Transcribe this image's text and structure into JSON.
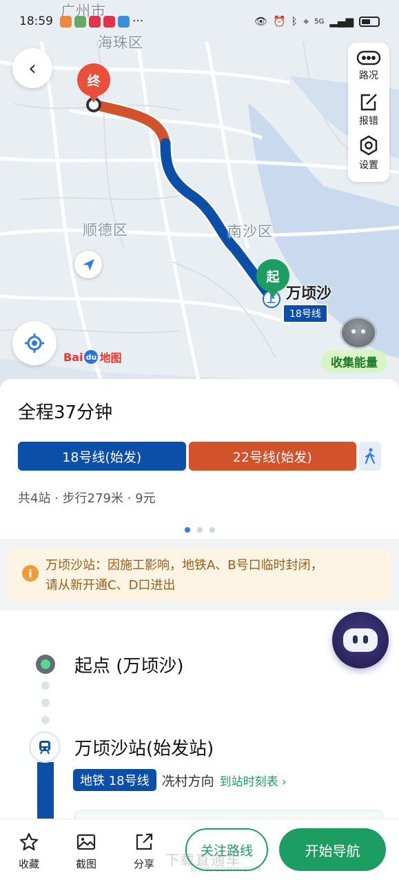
{
  "status_bar": {
    "time": "18:59",
    "dots": "···",
    "network": "5G"
  },
  "map": {
    "labels": [
      "广州市",
      "海珠区",
      "顺德区",
      "南沙区"
    ],
    "start_pin": "起",
    "end_pin": "终",
    "station_name": "万顷沙",
    "line_badge": "18号线",
    "boarding_marker": "上",
    "logo_text": "Bai",
    "logo_du": "du",
    "logo_suffix": "地图",
    "energy_label": "收集能量",
    "tools": [
      {
        "icon": "traffic-icon",
        "label": "路况"
      },
      {
        "icon": "report-icon",
        "label": "报错"
      },
      {
        "icon": "settings-icon",
        "label": "设置"
      }
    ],
    "back_glyph": "‹"
  },
  "summary": {
    "title": "全程37分钟",
    "segments": [
      {
        "label": "18号线(始发)",
        "color": "#0b4fa8"
      },
      {
        "label": "22号线(始发)",
        "color": "#d2522b"
      }
    ],
    "meta": "共4站 · 步行279米 · 9元",
    "page_count": 3,
    "page_active": 1
  },
  "notice": {
    "icon": "i",
    "line1": "万顷沙站：因施工影响，地铁A、B号口临时封闭，",
    "line2": "请从新开通C、D口进出"
  },
  "itinerary": {
    "origin": "起点 (万顷沙)",
    "station": "万顷沙站(始发站)",
    "metro_badge": "地铁 18号线",
    "direction": "冼村方向",
    "timetable": "到站时刻表 ›"
  },
  "bottom_bar": {
    "favorite": "收藏",
    "screenshot": "截图",
    "share": "分享",
    "follow": "关注路线",
    "navigate": "开始导航"
  },
  "watermark": {
    "main": "下载直通车",
    "sub": "WWW.GDMM.COM"
  },
  "colors": {
    "line18": "#0b4fa8",
    "line22": "#d2522b",
    "accent_green": "#1c9d62",
    "end_red": "#e94f3a"
  }
}
